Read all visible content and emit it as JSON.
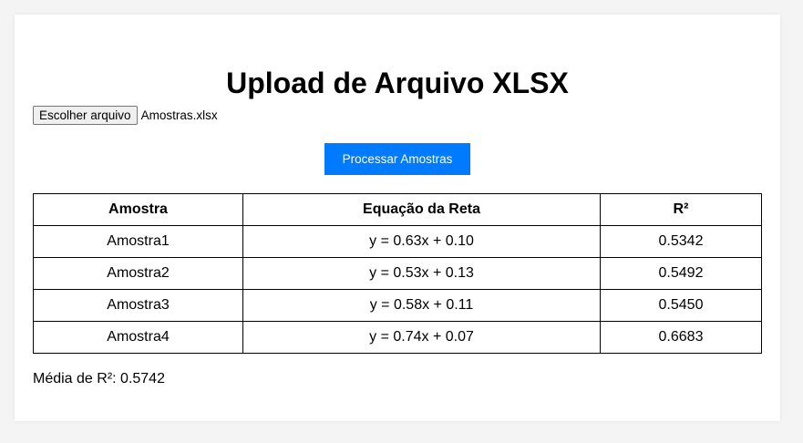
{
  "title": "Upload de Arquivo XLSX",
  "file_input": {
    "button_label": "Escolher arquivo",
    "file_name": "Amostras.xlsx"
  },
  "process_button": {
    "label": "Processar Amostras",
    "color": "#007bff"
  },
  "table": {
    "headers": [
      "Amostra",
      "Equação da Reta",
      "R²"
    ],
    "rows": [
      [
        "Amostra1",
        "y = 0.63x + 0.10",
        "0.5342"
      ],
      [
        "Amostra2",
        "y = 0.53x + 0.13",
        "0.5492"
      ],
      [
        "Amostra3",
        "y = 0.58x + 0.11",
        "0.5450"
      ],
      [
        "Amostra4",
        "y = 0.74x + 0.07",
        "0.6683"
      ]
    ]
  },
  "average": "Média de R²: 0.5742"
}
